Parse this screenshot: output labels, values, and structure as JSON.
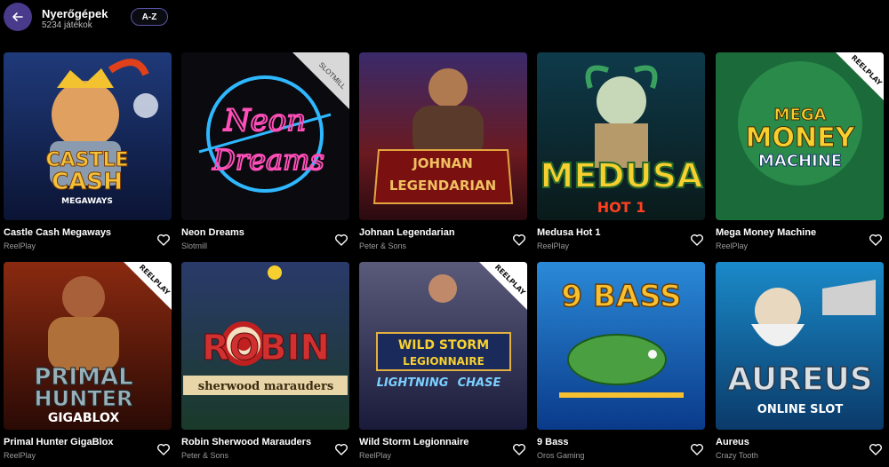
{
  "header": {
    "title": "Nyerőgépek",
    "count": "5234 játékok",
    "sort_label": "A-Z"
  },
  "games": [
    {
      "name": "Castle Cash Megaways",
      "provider": "ReelPlay",
      "art": [
        "CASTLE",
        "CASH",
        "MEGAWAYS"
      ]
    },
    {
      "name": "Neon Dreams",
      "provider": "Slotmill",
      "art": [
        "Neon",
        "Dreams",
        "SLOTMILL"
      ]
    },
    {
      "name": "Johnan Legendarian",
      "provider": "Peter & Sons",
      "art": [
        "JOHNAN",
        "LEGENDARIAN"
      ]
    },
    {
      "name": "Medusa Hot 1",
      "provider": "ReelPlay",
      "art": [
        "MEDUSA",
        "HOT 1"
      ]
    },
    {
      "name": "Mega Money Machine",
      "provider": "ReelPlay",
      "art": [
        "MEGA",
        "MONEY",
        "MACHINE",
        "REELPLAY"
      ]
    },
    {
      "name": "Primal Hunter GigaBlox",
      "provider": "ReelPlay",
      "art": [
        "PRIMAL",
        "HUNTER",
        "GIGABLOX",
        "REELPLAY"
      ]
    },
    {
      "name": "Robin Sherwood Marauders",
      "provider": "Peter & Sons",
      "art": [
        "ROBIN",
        "sherwood marauders"
      ]
    },
    {
      "name": "Wild Storm Legionnaire",
      "provider": "ReelPlay",
      "art": [
        "WILD STORM",
        "LEGIONNAIRE",
        "LIGHTNING",
        "CHASE",
        "REELPLAY"
      ]
    },
    {
      "name": "9 Bass",
      "provider": "Oros Gaming",
      "art": [
        "9 BASS"
      ]
    },
    {
      "name": "Aureus",
      "provider": "Crazy Tooth",
      "art": [
        "AUREUS",
        "ONLINE SLOT"
      ]
    }
  ],
  "colors": {
    "accent": "#4a3a8c",
    "background": "#000000"
  }
}
